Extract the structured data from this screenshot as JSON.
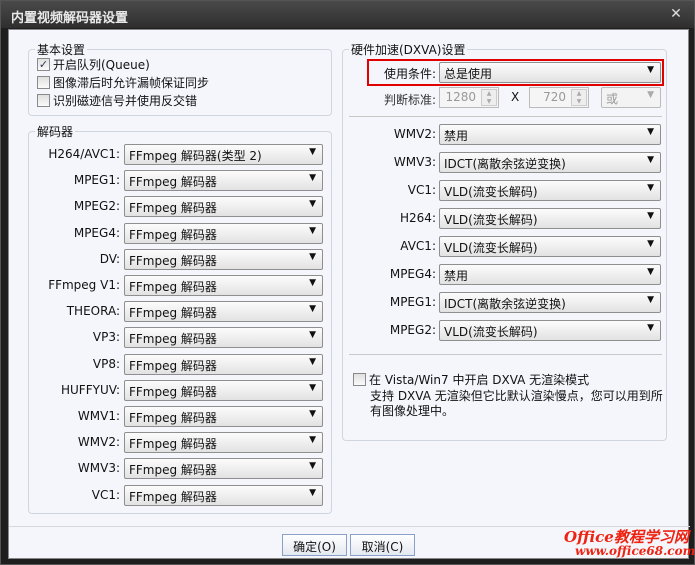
{
  "window": {
    "title": "内置视频解码器设置",
    "close": "✕"
  },
  "basic": {
    "title": "基本设置",
    "options": [
      {
        "label": "开启队列(Queue)",
        "checked": true
      },
      {
        "label": "图像滞后时允许漏帧保证同步",
        "checked": false
      },
      {
        "label": "识别磁迹信号并使用反交错",
        "checked": false
      }
    ]
  },
  "decoders": {
    "title": "解码器",
    "rows": [
      {
        "label": "H264/AVC1:",
        "value": "FFmpeg 解码器(类型 2)"
      },
      {
        "label": "MPEG1:",
        "value": "FFmpeg 解码器"
      },
      {
        "label": "MPEG2:",
        "value": "FFmpeg 解码器"
      },
      {
        "label": "MPEG4:",
        "value": "FFmpeg 解码器"
      },
      {
        "label": "DV:",
        "value": "FFmpeg 解码器"
      },
      {
        "label": "FFmpeg V1:",
        "value": "FFmpeg 解码器"
      },
      {
        "label": "THEORA:",
        "value": "FFmpeg 解码器"
      },
      {
        "label": "VP3:",
        "value": "FFmpeg 解码器"
      },
      {
        "label": "VP8:",
        "value": "FFmpeg 解码器"
      },
      {
        "label": "HUFFYUV:",
        "value": "FFmpeg 解码器"
      },
      {
        "label": "WMV1:",
        "value": "FFmpeg 解码器"
      },
      {
        "label": "WMV2:",
        "value": "FFmpeg 解码器"
      },
      {
        "label": "WMV3:",
        "value": "FFmpeg 解码器"
      },
      {
        "label": "VC1:",
        "value": "FFmpeg 解码器"
      }
    ]
  },
  "dxva": {
    "title": "硬件加速(DXVA)设置",
    "condition_label": "使用条件:",
    "condition_value": "总是使用",
    "criteria_label": "判断标准:",
    "width": "1280",
    "x": "X",
    "height": "720",
    "logic": "或",
    "highlight_color": "#e00000",
    "rows": [
      {
        "label": "WMV2:",
        "value": "禁用"
      },
      {
        "label": "WMV3:",
        "value": "IDCT(离散余弦逆变换)"
      },
      {
        "label": "VC1:",
        "value": "VLD(流变长解码)"
      },
      {
        "label": "H264:",
        "value": "VLD(流变长解码)"
      },
      {
        "label": "AVC1:",
        "value": "VLD(流变长解码)"
      },
      {
        "label": "MPEG4:",
        "value": "禁用"
      },
      {
        "label": "MPEG1:",
        "value": "IDCT(离散余弦逆变换)"
      },
      {
        "label": "MPEG2:",
        "value": "VLD(流变长解码)"
      }
    ],
    "norender_label": "在 Vista/Win7 中开启 DXVA 无渲染模式",
    "norender_checked": false,
    "norender_desc1": "支持 DXVA 无渲染但它比默认渲染慢点，您可以用到所",
    "norender_desc2": "有图像处理中。"
  },
  "buttons": {
    "ok": "确定(O)",
    "cancel": "取消(C)"
  },
  "watermark": {
    "line1": "Office教程学习网",
    "line2": "www.office68.com"
  }
}
